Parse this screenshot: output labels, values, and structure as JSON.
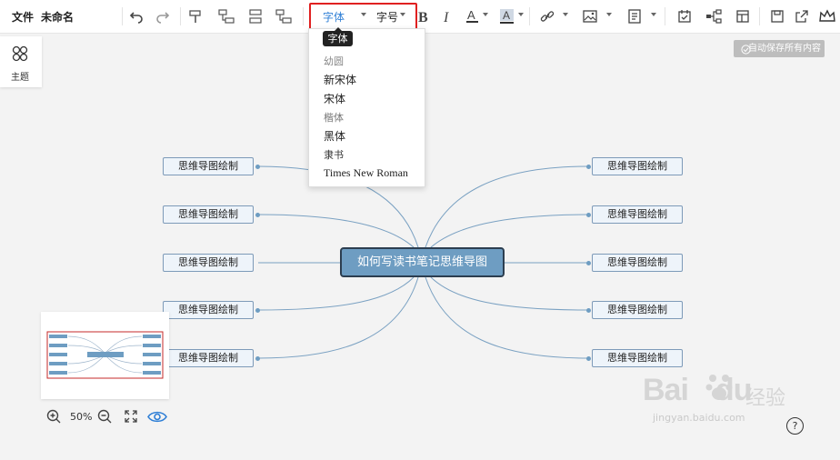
{
  "toolbar": {
    "file_label": "文件",
    "doc_name": "未命名",
    "font_label": "字体",
    "size_label": "字号",
    "font_tooltip": "字体"
  },
  "font_dropdown": {
    "options": [
      "幼圆",
      "新宋体",
      "宋体",
      "楷体",
      "黑体",
      "隶书",
      "Times New Roman"
    ]
  },
  "sidebar": {
    "theme_label": "主题"
  },
  "autosave": {
    "label": "自动保存所有内容"
  },
  "mindmap": {
    "center": "如何写读书笔记思维导图",
    "left_children": [
      "思维导图绘制",
      "思维导图绘制",
      "思维导图绘制",
      "思维导图绘制",
      "思维导图绘制"
    ],
    "right_children": [
      "思维导图绘制",
      "思维导图绘制",
      "思维导图绘制",
      "思维导图绘制",
      "思维导图绘制"
    ],
    "line_color": "#7aa1c2",
    "node_fill": "#6e9dc2"
  },
  "zoom": {
    "level": "50%"
  },
  "help": {
    "label": "?"
  },
  "watermark": {
    "brand": "Bai",
    "brand2": "du",
    "cn": "经验",
    "url": "jingyan.baidu.com"
  }
}
